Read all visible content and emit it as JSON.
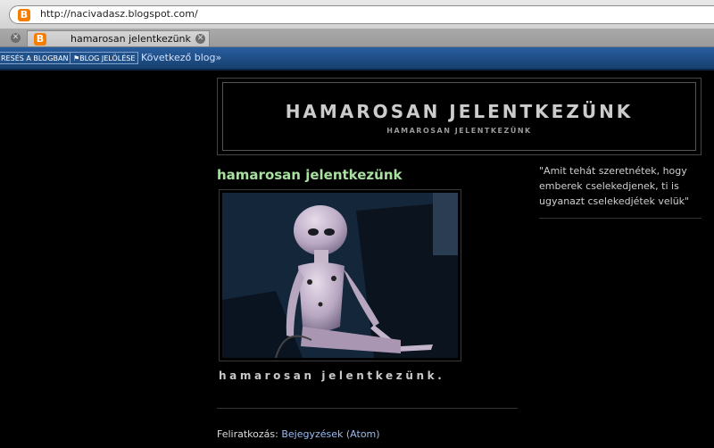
{
  "browser": {
    "url": "http://nacivadasz.blogspot.com/",
    "favicon_letter": "B",
    "tab_title": "hamarosan jelentkezünk",
    "tab_close_glyph": "✕"
  },
  "navbar": {
    "search_button": "RESÉS A BLOGBAN",
    "flag_button": "⚑BLOG JELÖLÉSE",
    "next_blog": "Következő blog»"
  },
  "blog": {
    "title": "HAMAROSAN JELENTKEZÜNK",
    "description": "HAMAROSAN JELENTKEZÜNK"
  },
  "post": {
    "title": "hamarosan jelentkezünk",
    "body": "hamarosan jelentkezünk."
  },
  "feed": {
    "label": "Feliratkozás:",
    "link": "Bejegyzések (Atom)"
  },
  "sidebar": {
    "quote": "\"Amit tehát szeretnétek, hogy emberek cselekedjenek, ti is ugyanazt cselekedjétek velük\""
  },
  "colors": {
    "page_bg": "#000000",
    "post_title": "#a8e0a0",
    "link": "#9bbcf0",
    "navbar": "#1f4f8a",
    "blogger_orange": "#f57d00"
  }
}
